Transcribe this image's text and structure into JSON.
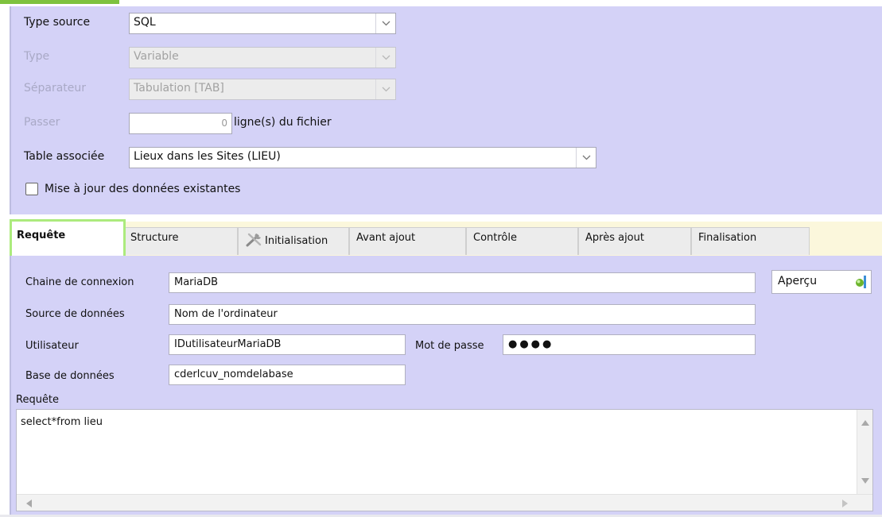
{
  "form": {
    "type_source": {
      "label": "Type source",
      "value": "SQL"
    },
    "type": {
      "label": "Type",
      "value": "Variable"
    },
    "separateur": {
      "label": "Séparateur",
      "value": "Tabulation [TAB]"
    },
    "passer": {
      "label": "Passer",
      "value": "0",
      "suffix": "ligne(s) du fichier"
    },
    "table_associee": {
      "label": "Table associée",
      "value": "Lieux dans les Sites (LIEU)"
    },
    "update_existing": {
      "label": "Mise à jour des données existantes",
      "checked": false
    }
  },
  "tabs": [
    {
      "label": "Requête",
      "active": true
    },
    {
      "label": "Structure"
    },
    {
      "label": "Initialisation",
      "icon": "tools-icon"
    },
    {
      "label": "Avant ajout"
    },
    {
      "label": "Contrôle"
    },
    {
      "label": "Après ajout"
    },
    {
      "label": "Finalisation"
    }
  ],
  "connection": {
    "chaine": {
      "label": "Chaine de connexion",
      "value": "MariaDB"
    },
    "source": {
      "label": "Source de données",
      "value": "Nom de l'ordinateur"
    },
    "utilisateur": {
      "label": "Utilisateur",
      "value": "IDutilisateurMariaDB"
    },
    "mot_de_passe": {
      "label": "Mot de passe",
      "value": "●●●●"
    },
    "base": {
      "label": "Base de données",
      "value": "cderlcuv_nomdelabase"
    },
    "apercu": {
      "label": "Aperçu",
      "icon": "preview-icon"
    }
  },
  "requete": {
    "label": "Requête",
    "value": "select*from lieu"
  },
  "colors": {
    "panel": "#d4d2f7",
    "tabbar": "#fbf7dc",
    "active_tab_border": "#aceb7d",
    "accent": "#7ec23e"
  }
}
